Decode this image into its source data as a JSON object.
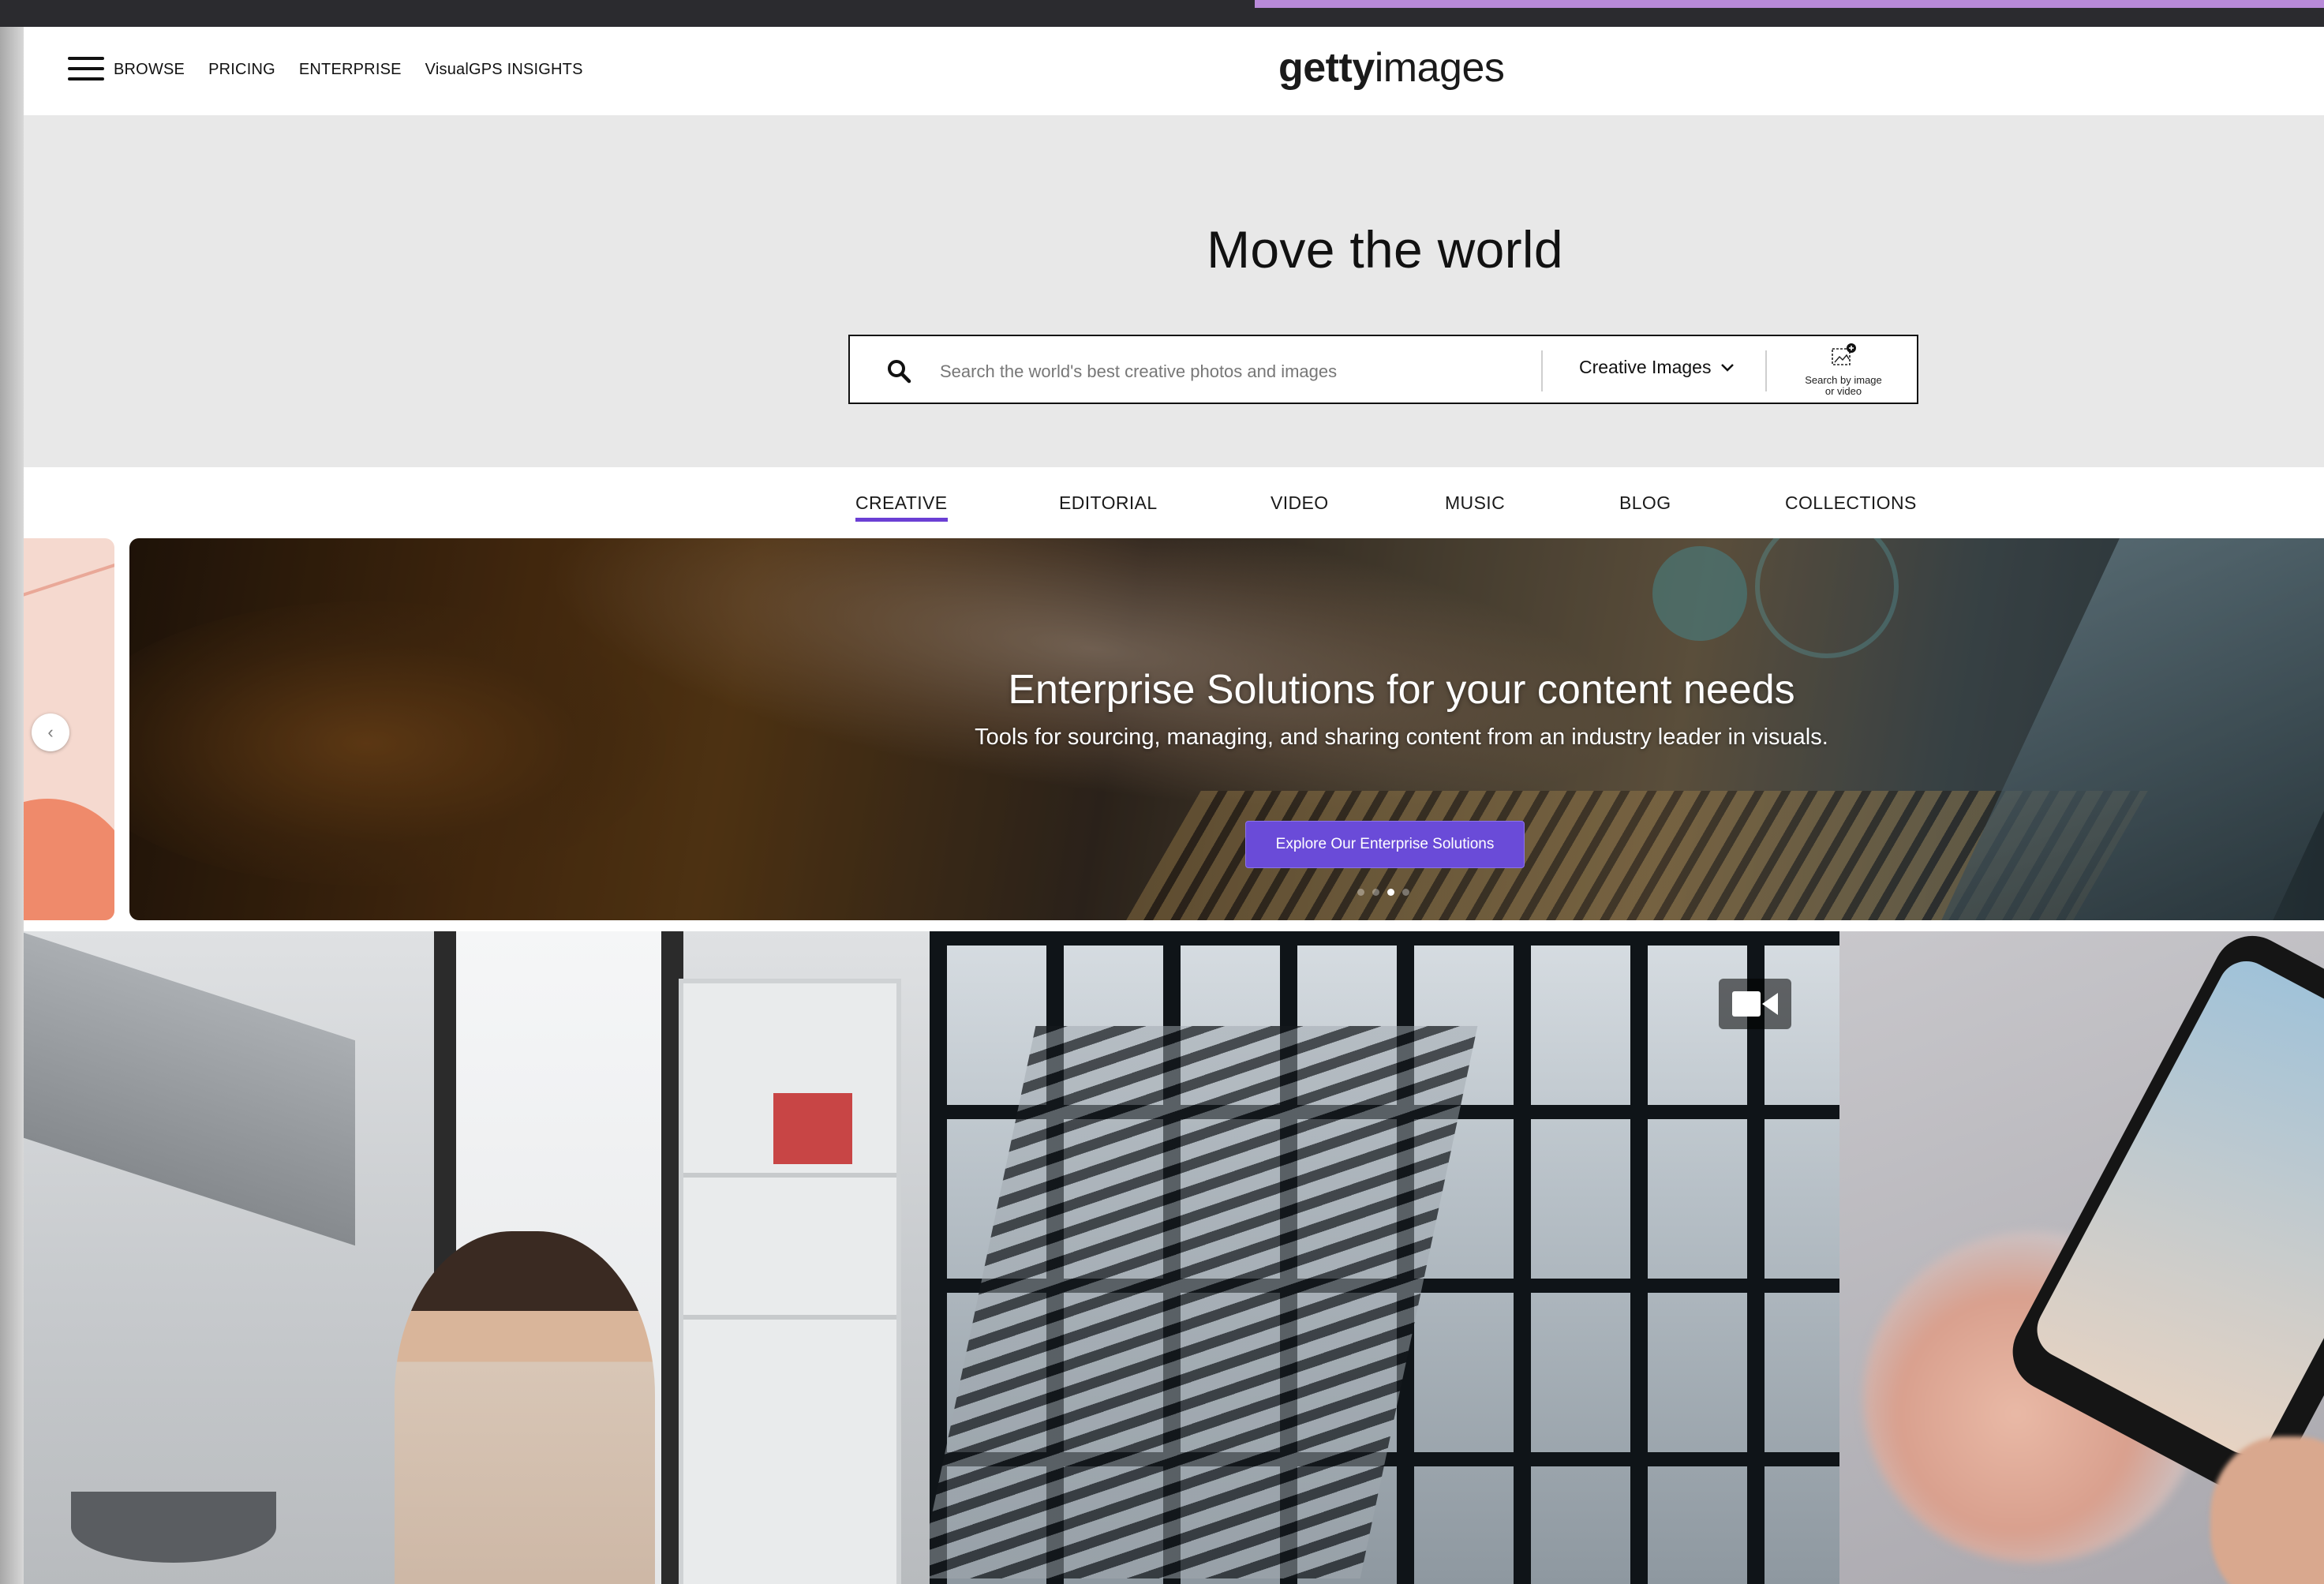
{
  "header": {
    "nav": [
      "BROWSE",
      "PRICING",
      "ENTERPRISE",
      "VisualGPS INSIGHTS"
    ],
    "logo_bold": "getty",
    "logo_light": "images"
  },
  "hero": {
    "title": "Move the world",
    "search": {
      "placeholder": "Search the world's best creative photos and images",
      "value": "",
      "type_selected": "Creative Images",
      "image_search_label_1": "Search by image",
      "image_search_label_2": "or video"
    }
  },
  "tabs": [
    {
      "label": "CREATIVE",
      "active": true
    },
    {
      "label": "EDITORIAL",
      "active": false
    },
    {
      "label": "VIDEO",
      "active": false
    },
    {
      "label": "MUSIC",
      "active": false
    },
    {
      "label": "BLOG",
      "active": false
    },
    {
      "label": "COLLECTIONS",
      "active": false
    }
  ],
  "banner": {
    "title": "Enterprise Solutions for your content needs",
    "subtitle": "Tools for sourcing, managing, and sharing content from an industry leader in visuals.",
    "cta": "Explore Our Enterprise Solutions",
    "slide_count": 4,
    "active_slide": 3
  },
  "carousel": {
    "prev_icon": "chevron-left-icon"
  },
  "tiles": [
    {
      "kind": "photo",
      "subject": "woman reading a receipt in kitchen"
    },
    {
      "kind": "video",
      "subject": "office building stairwell at night",
      "badge_icon": "video-camera-icon"
    },
    {
      "kind": "photo",
      "subject": "newborn baby photographed with phone"
    }
  ],
  "colors": {
    "accent": "#6b3fd4",
    "cta": "#6a4bd8",
    "hero_bg": "#e8e8e8",
    "text": "#1a1a1a"
  }
}
